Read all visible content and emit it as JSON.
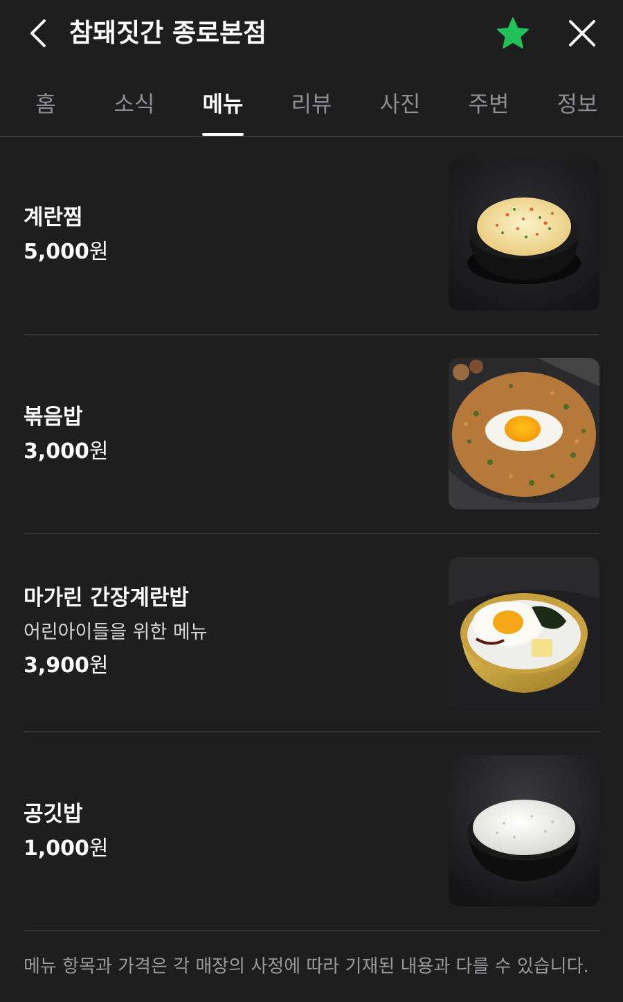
{
  "header": {
    "title": "참돼짓간 종로본점",
    "back_icon": "chevron-left-icon",
    "favorite_icon": "star-icon",
    "favorite_color": "#21c359",
    "close_icon": "close-icon"
  },
  "tabs": [
    {
      "label": "홈",
      "active": false
    },
    {
      "label": "소식",
      "active": false
    },
    {
      "label": "메뉴",
      "active": true
    },
    {
      "label": "리뷰",
      "active": false
    },
    {
      "label": "사진",
      "active": false
    },
    {
      "label": "주변",
      "active": false
    },
    {
      "label": "정보",
      "active": false
    }
  ],
  "menu": {
    "items": [
      {
        "name": "계란찜",
        "description": "",
        "price": "5,000",
        "currency": "원",
        "image_icon": "steamed-egg-photo"
      },
      {
        "name": "볶음밥",
        "description": "",
        "price": "3,000",
        "currency": "원",
        "image_icon": "fried-rice-photo"
      },
      {
        "name": "마가린 간장계란밥",
        "description": "어린아이들을 위한 메뉴",
        "price": "3,900",
        "currency": "원",
        "image_icon": "egg-rice-bowl-photo"
      },
      {
        "name": "공깃밥",
        "description": "",
        "price": "1,000",
        "currency": "원",
        "image_icon": "rice-bowl-photo"
      }
    ],
    "footer_note": "메뉴 항목과 가격은 각 매장의 사정에 따라 기재된 내용과 다를 수 있습니다."
  },
  "colors": {
    "background": "#1e1e1f",
    "text_primary": "#ffffff",
    "text_muted": "#8e8e93",
    "divider": "#333335"
  }
}
